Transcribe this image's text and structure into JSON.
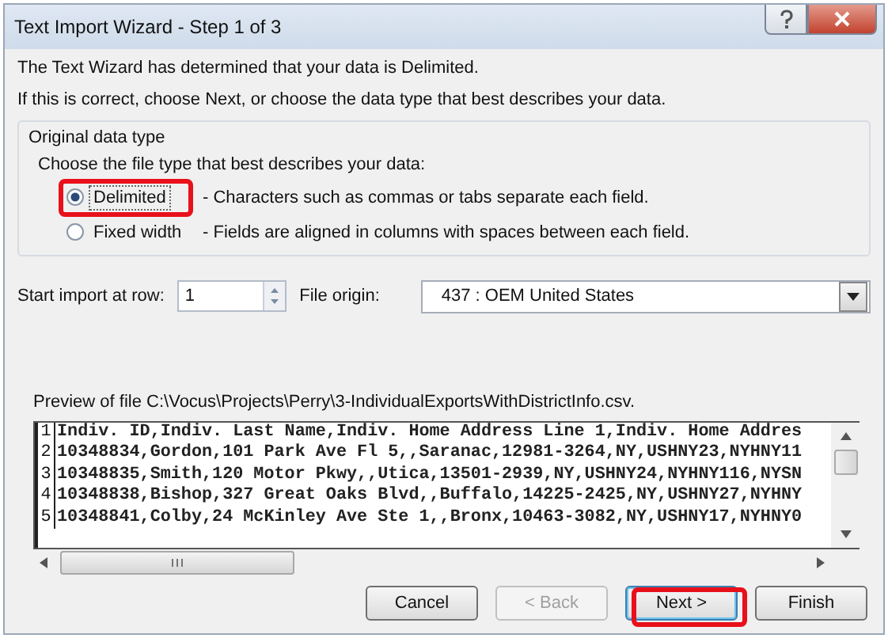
{
  "window": {
    "title": "Text Import Wizard - Step 1 of 3"
  },
  "intro": [
    "The Text Wizard has determined that your data is Delimited.",
    "If this is correct, choose Next, or choose the data type that best describes your data."
  ],
  "data_type": {
    "legend": "Original data type",
    "prompt": "Choose the file type that best describes your data:",
    "options": [
      {
        "label": "Delimited",
        "description": "- Characters such as commas or tabs separate each field.",
        "selected": true,
        "highlighted": true
      },
      {
        "label": "Fixed width",
        "description": "- Fields are aligned in columns with spaces between each field.",
        "selected": false,
        "highlighted": false
      }
    ]
  },
  "start_row": {
    "label": "Start import at row:",
    "value": "1"
  },
  "file_origin": {
    "label": "File origin:",
    "value": "437 : OEM United States"
  },
  "preview": {
    "label": "Preview of file C:\\Vocus\\Projects\\Perry\\3-IndividualExportsWithDistrictInfo.csv.",
    "rows": [
      {
        "number": "1",
        "text": "Indiv. ID,Indiv. Last Name,Indiv. Home Address Line 1,Indiv. Home Addres"
      },
      {
        "number": "2",
        "text": "10348834,Gordon,101 Park Ave Fl 5,,Saranac,12981-3264,NY,USHNY23,NYHNY11"
      },
      {
        "number": "3",
        "text": "10348835,Smith,120 Motor Pkwy,,Utica,13501-2939,NY,USHNY24,NYHNY116,NYSN"
      },
      {
        "number": "4",
        "text": "10348838,Bishop,327 Great Oaks Blvd,,Buffalo,14225-2425,NY,USHNY27,NYHNY"
      },
      {
        "number": "5",
        "text": "10348841,Colby,24 McKinley Ave Ste 1,,Bronx,10463-3082,NY,USHNY17,NYHNY0"
      }
    ]
  },
  "buttons": [
    {
      "label": "Cancel",
      "disabled": false,
      "highlighted": false
    },
    {
      "label": "< Back",
      "disabled": true,
      "highlighted": false
    },
    {
      "label": "Next >",
      "disabled": false,
      "highlighted": true
    },
    {
      "label": "Finish",
      "disabled": false,
      "highlighted": false
    }
  ]
}
